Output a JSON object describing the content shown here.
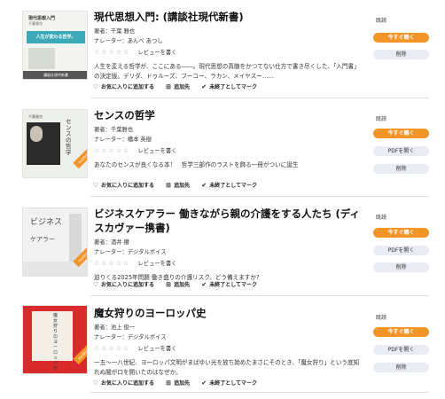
{
  "labels": {
    "author_prefix": "著者：",
    "narrator_prefix": "ナレーター：",
    "review_link": "レビューを書く",
    "stars": "☆☆☆☆☆",
    "favorite": "お気に入りに追加する",
    "add_to": "追加先",
    "mark_unfinished": "未終了としてマーク",
    "status_text": "既読",
    "listen_now": "今すぐ聴く",
    "open_pdf": "PDFを開く",
    "delete": "削除"
  },
  "covers": [
    {
      "top_text": "現代思想入門",
      "sub_text": "千葉雅也",
      "mid_text": "人生が変わる哲学。",
      "band_text": "講談社現代新書"
    },
    {
      "top_text": "千葉雅也",
      "sub_text": "センスの哲学",
      "band_text": "Audible"
    },
    {
      "top_text": "ビジネス",
      "sub_text": "ケアラー",
      "band_text": "Audible"
    },
    {
      "top_text": "魔女狩りのヨーロッパ史",
      "band_text": "Audible"
    }
  ],
  "books": [
    {
      "title": "現代思想入門: (講談社現代新書)",
      "author": "千葉 雅也",
      "narrator": "あんべ あつし",
      "description": "人生を変える哲学が、ここにある――。現代思想の真髄をかつてない仕方で書き尽くした、「入門書」の決定版。デリダ、ドゥルーズ、フーコー、ラカン、メイヤスー……"
    },
    {
      "title": "センスの哲学",
      "author": "千葉雅也",
      "narrator": "橋本 英樹",
      "description": "あなたのセンスが良くなる本！　哲学三部作のラストを飾る一冊がついに誕生"
    },
    {
      "title": "ビジネスケアラー 働きながら親の介護をする人たち (ディスカヴァー携書)",
      "author": "酒井 穣",
      "narrator": "デジタルボイス",
      "description": "迫りくる2025年問題 働き盛りの介護リスク、どう備えますか?"
    },
    {
      "title": "魔女狩りのヨーロッパ史",
      "author": "池上 俊一",
      "narrator": "デジタルボイス",
      "description": "一五〜一八世紀、ヨーロッパ文明がまばゆい光を放ち始めたまさにそのとき、「魔女狩り」という底知れぬ闇が口を開いたのはなぜか。"
    }
  ],
  "colors": {
    "accent": "#f39428",
    "secondary_button": "#e9edf3"
  }
}
